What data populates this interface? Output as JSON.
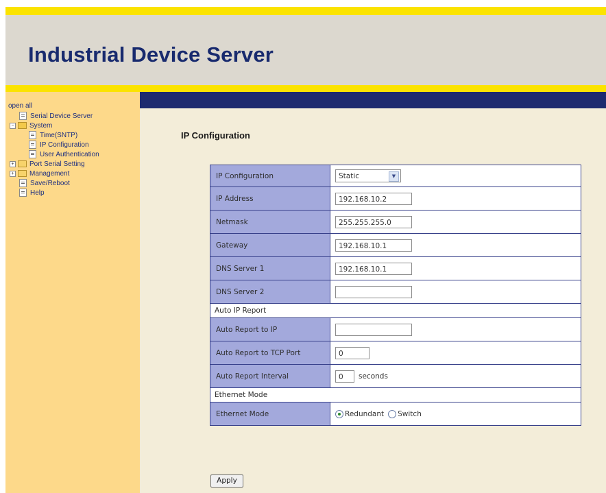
{
  "header": {
    "title": "Industrial Device Server"
  },
  "sidebar": {
    "open_all": "open all",
    "items": [
      {
        "label": "Serial Device Server",
        "icon": "doc-icon"
      },
      {
        "label": "System",
        "icon": "folder-open-icon",
        "expanded": true
      },
      {
        "label": "Time(SNTP)",
        "icon": "doc-icon"
      },
      {
        "label": "IP Configuration",
        "icon": "doc-icon"
      },
      {
        "label": "User Authentication",
        "icon": "doc-icon"
      },
      {
        "label": "Port Serial Setting",
        "icon": "folder-icon",
        "expanded": false
      },
      {
        "label": "Management",
        "icon": "folder-icon",
        "expanded": false
      },
      {
        "label": "Save/Reboot",
        "icon": "doc-icon"
      },
      {
        "label": "Help",
        "icon": "doc-icon"
      }
    ]
  },
  "main": {
    "page_title": "IP Configuration",
    "fields": {
      "ip_config": {
        "label": "IP Configuration",
        "value": "Static"
      },
      "ip_address": {
        "label": "IP Address",
        "value": "192.168.10.2"
      },
      "netmask": {
        "label": "Netmask",
        "value": "255.255.255.0"
      },
      "gateway": {
        "label": "Gateway",
        "value": "192.168.10.1"
      },
      "dns1": {
        "label": "DNS Server 1",
        "value": "192.168.10.1"
      },
      "dns2": {
        "label": "DNS Server 2",
        "value": ""
      }
    },
    "auto_ip_section": "Auto IP Report",
    "auto_ip": {
      "report_ip": {
        "label": "Auto Report to IP",
        "value": ""
      },
      "report_port": {
        "label": "Auto Report to TCP Port",
        "value": "0"
      },
      "report_interval": {
        "label": "Auto Report Interval",
        "value": "0",
        "unit": "seconds"
      }
    },
    "ethernet_section": "Ethernet Mode",
    "ethernet": {
      "label": "Ethernet Mode",
      "option_redundant": "Redundant",
      "option_switch": "Switch",
      "selected": "Redundant"
    },
    "apply_label": "Apply"
  },
  "colors": {
    "accent_yellow": "#fbe300",
    "header_bg": "#dcd8cf",
    "title_blue": "#182a6e",
    "sidebar_bg": "#fdd98a",
    "nav_strip": "#1d2a6f",
    "label_cell": "#a3a9dc",
    "content_bg": "#f3edd9"
  }
}
